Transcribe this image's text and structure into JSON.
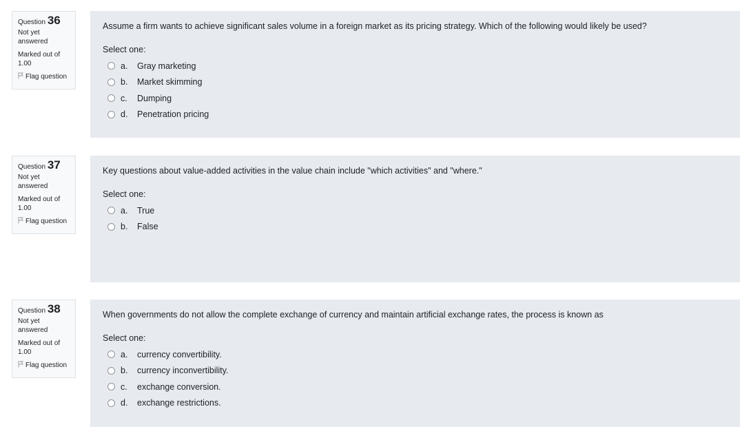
{
  "questions": [
    {
      "label": "Question",
      "number": "36",
      "state": "Not yet answered",
      "grade": "Marked out of 1.00",
      "flag_label": "Flag question",
      "text": "Assume a firm wants to achieve significant sales volume in a foreign market as its pricing strategy. Which of the following would likely be used?",
      "prompt": "Select one:",
      "options": [
        {
          "letter": "a.",
          "text": "Gray marketing"
        },
        {
          "letter": "b.",
          "text": "Market skimming"
        },
        {
          "letter": "c.",
          "text": "Dumping"
        },
        {
          "letter": "d.",
          "text": "Penetration pricing"
        }
      ]
    },
    {
      "label": "Question",
      "number": "37",
      "state": "Not yet answered",
      "grade": "Marked out of 1.00",
      "flag_label": "Flag question",
      "text": "Key questions about value-added activities in the value chain include \"which activities\" and \"where.\"",
      "prompt": "Select one:",
      "options": [
        {
          "letter": "a.",
          "text": "True"
        },
        {
          "letter": "b.",
          "text": "False"
        }
      ]
    },
    {
      "label": "Question",
      "number": "38",
      "state": "Not yet answered",
      "grade": "Marked out of 1.00",
      "flag_label": "Flag question",
      "text": "When governments do not allow the complete exchange of currency and maintain artificial exchange rates, the process is known as",
      "prompt": "Select one:",
      "options": [
        {
          "letter": "a.",
          "text": "currency convertibility."
        },
        {
          "letter": "b.",
          "text": "currency inconvertibility."
        },
        {
          "letter": "c.",
          "text": "exchange conversion."
        },
        {
          "letter": "d.",
          "text": "exchange restrictions."
        }
      ]
    }
  ]
}
